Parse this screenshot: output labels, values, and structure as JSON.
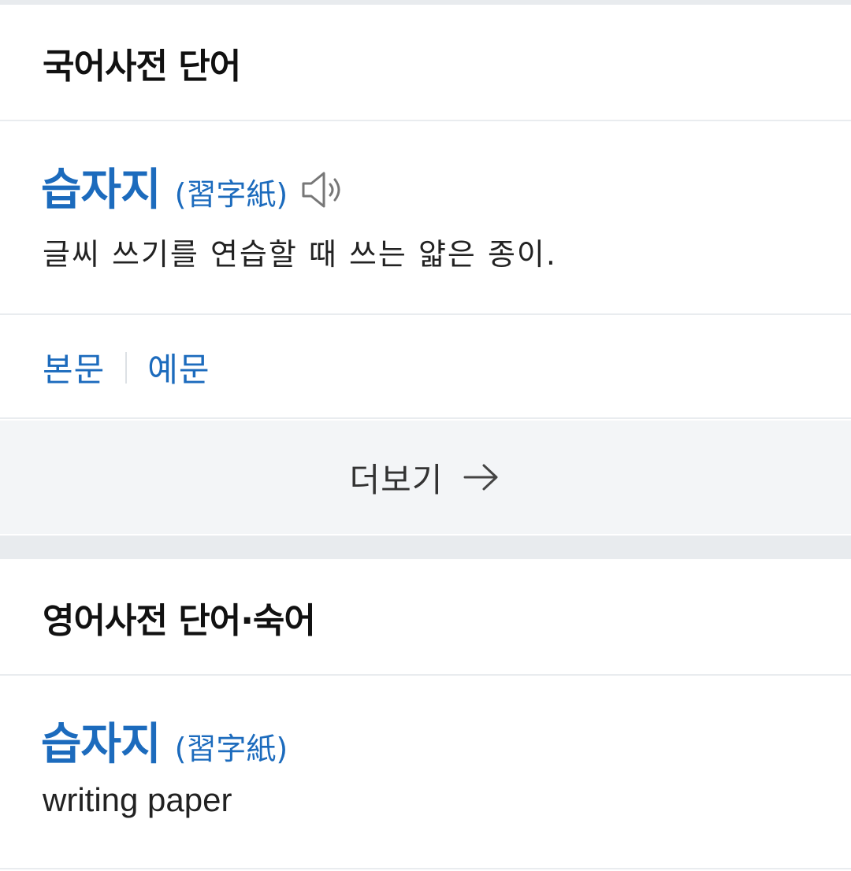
{
  "korean_dict": {
    "section_title": "국어사전 단어",
    "entry": {
      "headword": "습자지",
      "hanja": "(習字紙)",
      "definition": "글씨 쓰기를 연습할 때 쓰는 얇은 종이."
    },
    "links": [
      "본문",
      "예문"
    ],
    "more_label": "더보기"
  },
  "english_dict": {
    "section_title": "영어사전 단어·숙어",
    "entry": {
      "headword": "습자지",
      "hanja": "(習字紙)",
      "translation": "writing paper"
    }
  },
  "colors": {
    "link_blue": "#1c6bbd",
    "divider": "#e9ecef",
    "more_bg": "#f3f5f7",
    "section_gap": "#e8ebee"
  },
  "icons": {
    "speaker": "speaker-icon",
    "arrow": "arrow-right-icon"
  }
}
